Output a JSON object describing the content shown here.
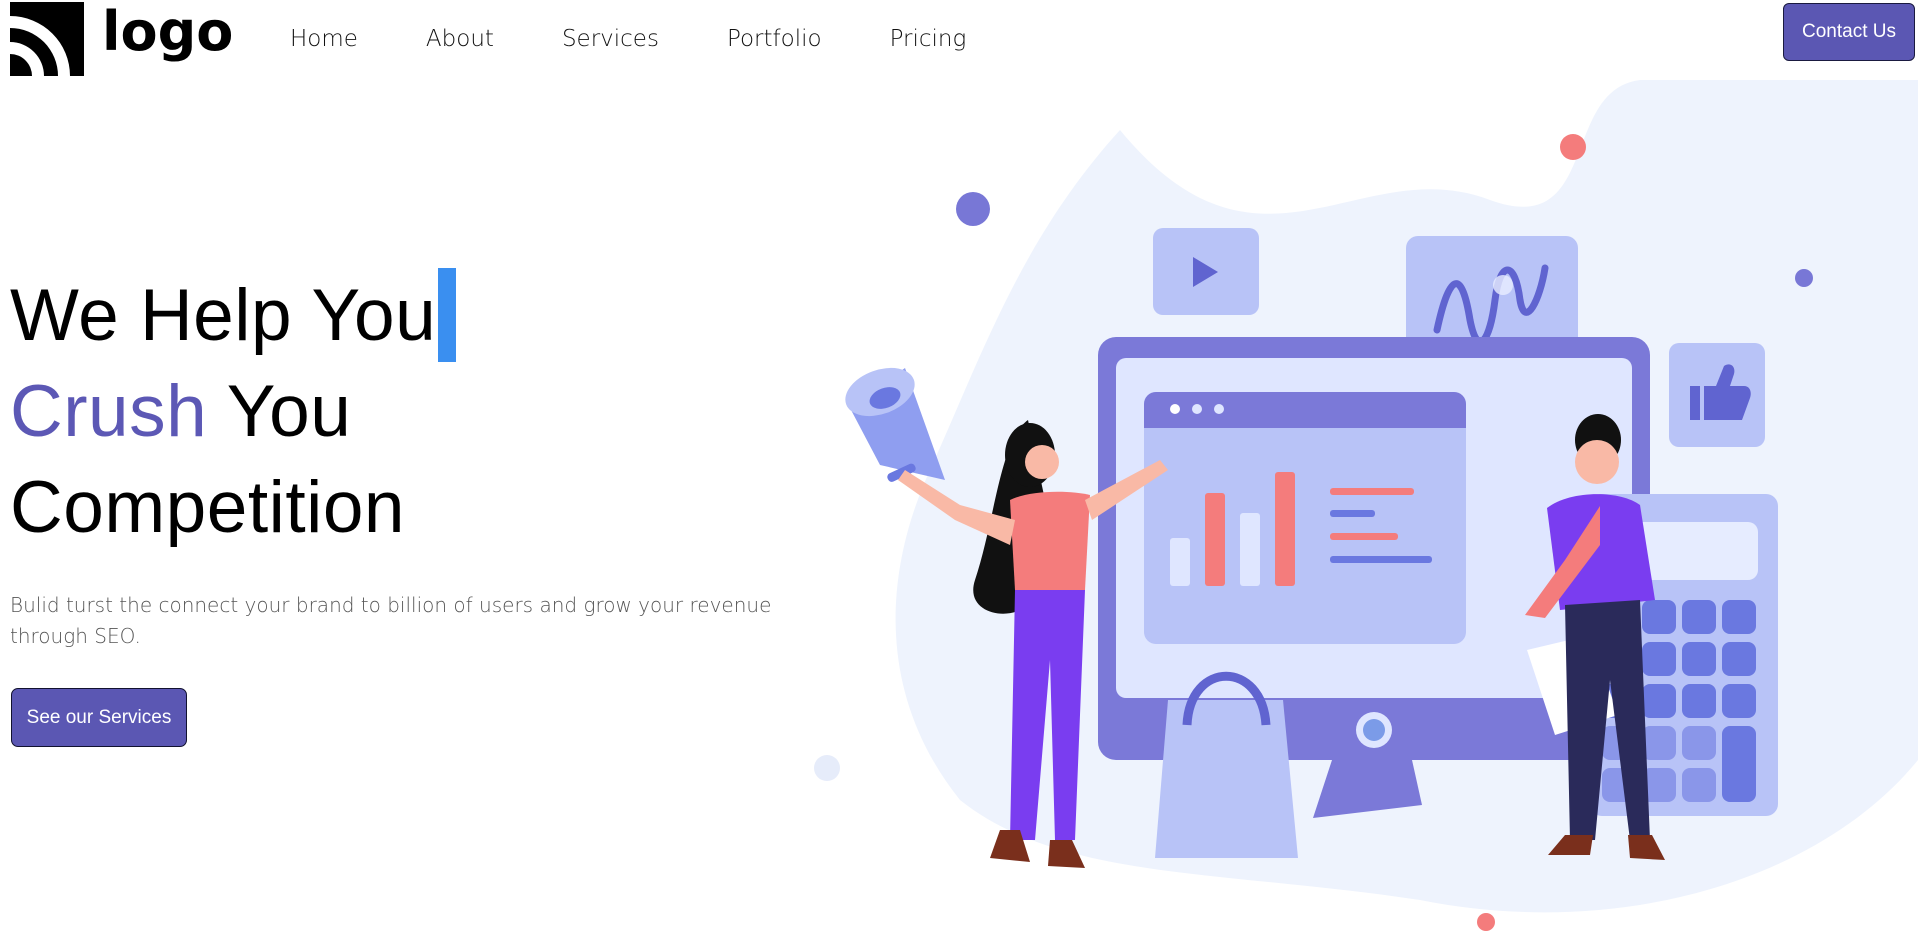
{
  "brand": {
    "logo_text": "logo"
  },
  "nav": {
    "items": [
      {
        "label": "Home"
      },
      {
        "label": "About"
      },
      {
        "label": "Services"
      },
      {
        "label": "Portfolio"
      },
      {
        "label": "Pricing"
      }
    ]
  },
  "header": {
    "contact_label": "Contact Us"
  },
  "hero": {
    "line1": "We Help You",
    "line2_accent": "Crush",
    "line2_rest": " You",
    "line3": "Competition",
    "description": "Bulid turst the connect your brand to billion of users and grow your revenue through SEO.",
    "cta_label": "See our Services"
  },
  "colors": {
    "accent": "#5c58b5",
    "button": "#5b57b3",
    "cursor": "#3a8ff0"
  },
  "icons": [
    "rss-logo-icon",
    "play-icon",
    "chart-wave-icon",
    "thumbs-up-icon",
    "megaphone-icon",
    "calculator-icon",
    "shopping-bag-icon"
  ]
}
